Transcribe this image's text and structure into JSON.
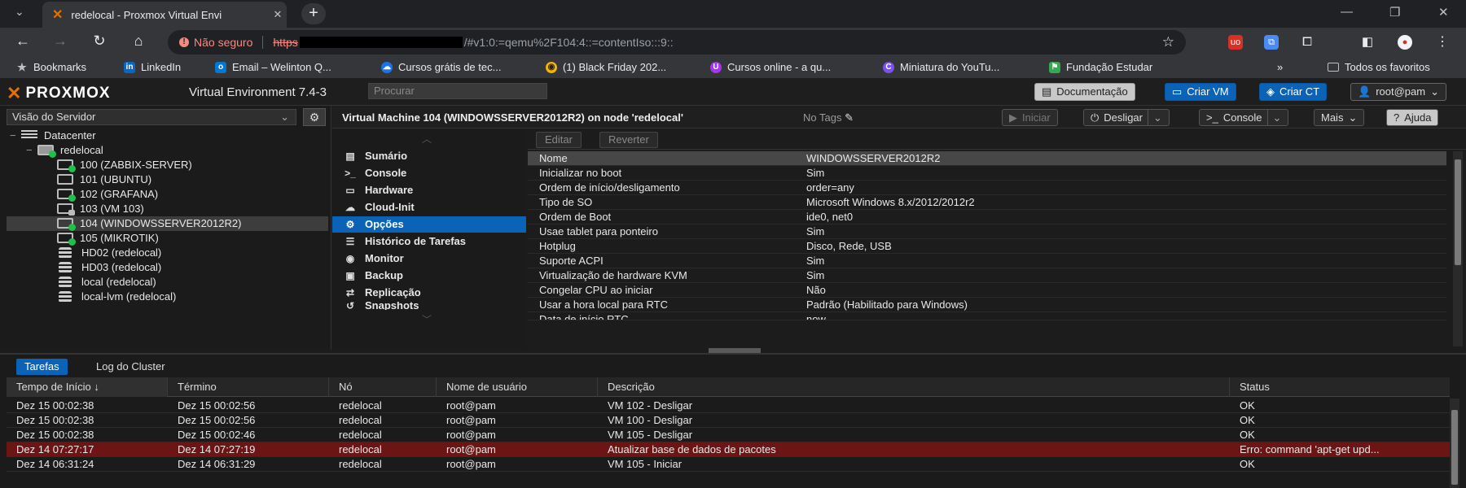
{
  "browser": {
    "tab_title": "redelocal - Proxmox Virtual Envi",
    "url_security": "Não seguro",
    "url_scheme": "https",
    "url_rest": "/#v1:0:=qemu%2F104:4::=contentIso:::9::",
    "bookmarks": [
      {
        "label": "Bookmarks",
        "icon": "star-icon",
        "color": "#bdc1c6"
      },
      {
        "label": "LinkedIn",
        "icon": "linkedin-icon",
        "color": "#0a66c2"
      },
      {
        "label": "Email – Welinton Q...",
        "icon": "outlook-icon",
        "color": "#0078d4"
      },
      {
        "label": "Cursos grátis de tec...",
        "icon": "cloud-icon",
        "color": "#1a73e8"
      },
      {
        "label": "(1) Black Friday 202...",
        "icon": "eye-icon",
        "color": "#f4b400"
      },
      {
        "label": "Cursos online - a qu...",
        "icon": "udemy-icon",
        "color": "#a435f0"
      },
      {
        "label": "Miniatura do YouTu...",
        "icon": "canva-icon",
        "color": "#00c4cc"
      },
      {
        "label": "Fundação Estudar",
        "icon": "flag-icon",
        "color": "#34a853"
      }
    ],
    "all_bookmarks": "Todos os favoritos"
  },
  "pve": {
    "version": "Virtual Environment 7.4-3",
    "search_placeholder": "Procurar",
    "header_buttons": {
      "docs": "Documentação",
      "create_vm": "Criar VM",
      "create_ct": "Criar CT",
      "user": "root@pam"
    },
    "tree": {
      "view": "Visão do Servidor",
      "nodes": [
        {
          "label": "Datacenter",
          "kind": "datacenter",
          "indent": 0
        },
        {
          "label": "redelocal",
          "kind": "node",
          "indent": 1
        },
        {
          "label": "100 (ZABBIX-SERVER)",
          "kind": "vm-run",
          "indent": 2
        },
        {
          "label": "101 (UBUNTU)",
          "kind": "vm",
          "indent": 2
        },
        {
          "label": "102 (GRAFANA)",
          "kind": "vm-run",
          "indent": 2
        },
        {
          "label": "103 (VM 103)",
          "kind": "vm-lock",
          "indent": 2
        },
        {
          "label": "104 (WINDOWSSERVER2012R2)",
          "kind": "vm-run",
          "indent": 2,
          "selected": true
        },
        {
          "label": "105 (MIKROTIK)",
          "kind": "vm-run",
          "indent": 2
        },
        {
          "label": "HD02 (redelocal)",
          "kind": "storage",
          "indent": 2
        },
        {
          "label": "HD03 (redelocal)",
          "kind": "storage",
          "indent": 2
        },
        {
          "label": "local (redelocal)",
          "kind": "storage",
          "indent": 2
        },
        {
          "label": "local-lvm (redelocal)",
          "kind": "storage",
          "indent": 2
        }
      ]
    },
    "vm": {
      "title": "Virtual Machine 104 (WINDOWSSERVER2012R2) on node 'redelocal'",
      "tags": "No Tags",
      "buttons": {
        "start": "Iniciar",
        "shutdown": "Desligar",
        "console": "Console",
        "more": "Mais",
        "help": "Ajuda"
      }
    },
    "submenu": [
      {
        "label": "Sumário",
        "icon": "summary-icon",
        "glyph": "▤"
      },
      {
        "label": "Console",
        "icon": "terminal-icon",
        "glyph": ">_"
      },
      {
        "label": "Hardware",
        "icon": "desktop-icon",
        "glyph": "▭"
      },
      {
        "label": "Cloud-Init",
        "icon": "cloud-icon",
        "glyph": "☁"
      },
      {
        "label": "Opções",
        "icon": "gear-icon",
        "glyph": "⚙",
        "selected": true
      },
      {
        "label": "Histórico de Tarefas",
        "icon": "list-icon",
        "glyph": "☰"
      },
      {
        "label": "Monitor",
        "icon": "eye-icon",
        "glyph": "◉"
      },
      {
        "label": "Backup",
        "icon": "floppy-icon",
        "glyph": "▣"
      },
      {
        "label": "Replicação",
        "icon": "retweet-icon",
        "glyph": "⇄"
      },
      {
        "label": "Snapshots",
        "icon": "history-icon",
        "glyph": "↺"
      }
    ],
    "options_toolbar": {
      "edit": "Editar",
      "revert": "Reverter"
    },
    "options": [
      {
        "k": "Nome",
        "v": "WINDOWSSERVER2012R2"
      },
      {
        "k": "Inicializar no boot",
        "v": "Sim"
      },
      {
        "k": "Ordem de início/desligamento",
        "v": "order=any"
      },
      {
        "k": "Tipo de SO",
        "v": "Microsoft Windows 8.x/2012/2012r2"
      },
      {
        "k": "Ordem de Boot",
        "v": "ide0, net0"
      },
      {
        "k": "Usae tablet para ponteiro",
        "v": "Sim"
      },
      {
        "k": "Hotplug",
        "v": "Disco, Rede, USB"
      },
      {
        "k": "Suporte ACPI",
        "v": "Sim"
      },
      {
        "k": "Virtualização de hardware KVM",
        "v": "Sim"
      },
      {
        "k": "Congelar CPU ao iniciar",
        "v": "Não"
      },
      {
        "k": "Usar a hora local para RTC",
        "v": "Padrão (Habilitado para Windows)"
      },
      {
        "k": "Data de início RTC",
        "v": "now"
      }
    ],
    "tasks": {
      "tabs": [
        "Tarefas",
        "Log do Cluster"
      ],
      "columns": [
        "Tempo de Início ↓",
        "Término",
        "Nó",
        "Nome de usuário",
        "Descrição",
        "Status"
      ],
      "rows": [
        {
          "start": "Dez 15 00:02:38",
          "end": "Dez 15 00:02:56",
          "node": "redelocal",
          "user": "root@pam",
          "desc": "VM 102 - Desligar",
          "status": "OK"
        },
        {
          "start": "Dez 15 00:02:38",
          "end": "Dez 15 00:02:56",
          "node": "redelocal",
          "user": "root@pam",
          "desc": "VM 100 - Desligar",
          "status": "OK"
        },
        {
          "start": "Dez 15 00:02:38",
          "end": "Dez 15 00:02:46",
          "node": "redelocal",
          "user": "root@pam",
          "desc": "VM 105 - Desligar",
          "status": "OK"
        },
        {
          "start": "Dez 14 07:27:17",
          "end": "Dez 14 07:27:19",
          "node": "redelocal",
          "user": "root@pam",
          "desc": "Atualizar base de dados de pacotes",
          "status": "Erro: command 'apt-get upd...",
          "error": true
        },
        {
          "start": "Dez 14 06:31:24",
          "end": "Dez 14 06:31:29",
          "node": "redelocal",
          "user": "root@pam",
          "desc": "VM 105 - Iniciar",
          "status": "OK"
        }
      ]
    }
  }
}
